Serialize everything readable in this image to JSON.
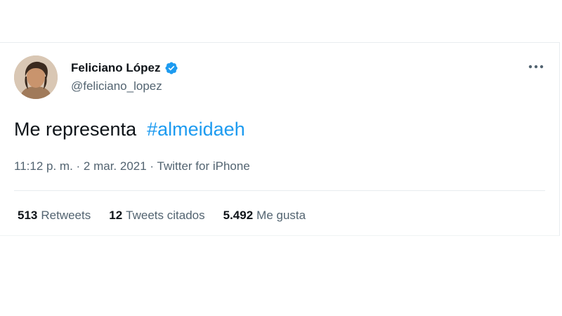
{
  "tweet": {
    "author": {
      "display_name": "Feliciano López",
      "handle": "@feliciano_lopez",
      "verified": true
    },
    "text_plain": "Me representa",
    "hashtag": "#almeidaeh",
    "timestamp": "11:12 p. m. · 2 mar. 2021",
    "separator": " · ",
    "source": "Twitter for iPhone",
    "stats": [
      {
        "count": "513",
        "label": "Retweets"
      },
      {
        "count": "12",
        "label": "Tweets citados"
      },
      {
        "count": "5.492",
        "label": "Me gusta"
      }
    ],
    "colors": {
      "accent": "#1d9bf0",
      "text": "#0f1419",
      "secondary": "#536471"
    },
    "icons": [
      "verified-badge-icon",
      "more-options-icon"
    ]
  }
}
